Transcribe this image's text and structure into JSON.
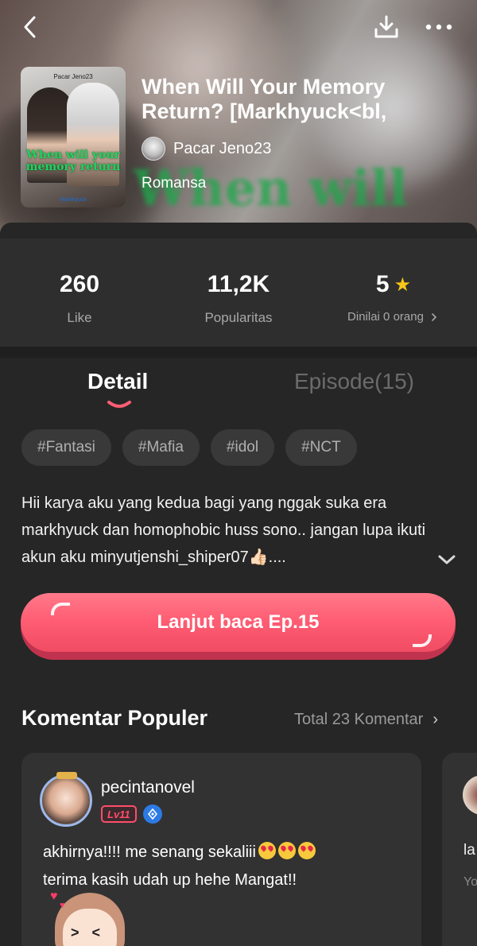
{
  "book": {
    "title": "When Will Your Memory Return? [Markhyuck<bl,",
    "author": "Pacar Jeno23",
    "genre": "Romansa",
    "cover_author": "Pacar Jeno23",
    "cover_title": "When will your memory return",
    "cover_sub": "Markhyuck",
    "bg_title": "When will"
  },
  "stats": {
    "likes_value": "260",
    "likes_label": "Like",
    "popularity_value": "11,2K",
    "popularity_label": "Popularitas",
    "rating_value": "5",
    "rating_label": "Dinilai 0 orang"
  },
  "tabs": {
    "detail": "Detail",
    "episode": "Episode(15)"
  },
  "tags": [
    "#Fantasi",
    "#Mafia",
    "#idol",
    "#NCT"
  ],
  "description": "Hii karya aku yang kedua bagi yang nggak suka era markhyuck dan homophobic huss sono.. jangan lupa ikuti akun aku minyutjenshi_shiper07👍🏻....",
  "cta": {
    "label": "Lanjut baca Ep.15"
  },
  "comments_section": {
    "title": "Komentar Populer",
    "total": "Total 23 Komentar",
    "items": [
      {
        "user": "pecintanovel",
        "level": "Lv11",
        "text_line1": "akhirnya!!!! me senang sekaliii",
        "text_line2": "terima kasih udah up hehe Mangat!!"
      },
      {
        "text_partial": "la",
        "sub_partial": "Yo"
      }
    ]
  },
  "icons": {
    "back": "chevron-left-icon",
    "download": "download-icon",
    "more": "more-horizontal-icon",
    "star": "star-icon",
    "expand": "chevron-down-icon"
  },
  "colors": {
    "accent_pink": "#ff5e74",
    "star": "#f5c518",
    "level_badge": "#ff4d6a",
    "gem": "#2c7be5"
  }
}
